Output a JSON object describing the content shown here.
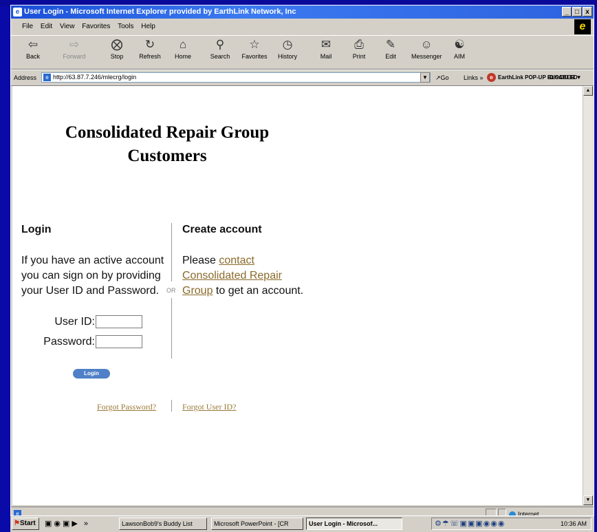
{
  "window": {
    "title": "User Login - Microsoft Internet Explorer provided by EarthLink Network, Inc",
    "controls": [
      "_",
      "&#9633;",
      "x"
    ]
  },
  "menu": [
    "File",
    "Edit",
    "View",
    "Favorites",
    "Tools",
    "Help"
  ],
  "toolbar": {
    "back": "Back",
    "forward": "Forward",
    "stop": "Stop",
    "refresh": "Refresh",
    "home": "Home",
    "search": "Search",
    "favorites": "Favorites",
    "history": "History",
    "mail": "Mail",
    "print": "Print",
    "edit": "Edit",
    "messenger": "Messenger",
    "aim": "AIM"
  },
  "address": {
    "label": "Address",
    "url": "http://63.87.7.246/mlecrg/login",
    "go": "Go",
    "links": "Links",
    "earthlink": "EarthLink POP-UP BLOCKER",
    "disabled": "DISABLED"
  },
  "page": {
    "heading_line1": "Consolidated Repair Group",
    "heading_line2": "Customers",
    "login": {
      "title": "Login",
      "line1": "If you have an active account",
      "line2": "you can sign on by providing",
      "line3": "your User ID and Password.",
      "userid_label": "User ID:",
      "password_label": "Password:",
      "userid_value": "",
      "password_value": "",
      "button": "Login"
    },
    "or": "OR",
    "create": {
      "title": "Create account",
      "please": "Please",
      "link_line1": "contact",
      "link_line2": "Consolidated Repair",
      "link_line3": "Group",
      "suffix": "to get an account."
    },
    "forgot_password": "Forgot Password?",
    "forgot_userid": "Forgot User ID?"
  },
  "statusbar": {
    "zone": "Internet"
  },
  "taskbar": {
    "start": "Start",
    "tasks": [
      "LawsonBob9's Buddy List",
      "Microsoft PowerPoint - [CR",
      "User Login - Microsof..."
    ],
    "clock": "10:36 AM"
  }
}
